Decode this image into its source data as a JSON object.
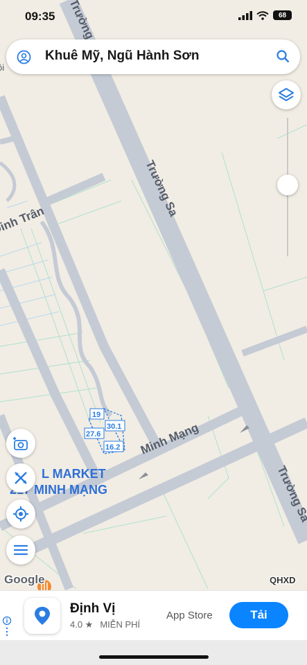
{
  "status_bar": {
    "time": "09:35",
    "battery": "68"
  },
  "search": {
    "query": "Khuê Mỹ, Ngũ Hành Sơn"
  },
  "map": {
    "street_labels": [
      "Trường Sa",
      "Trường Sa",
      "Trường Sa",
      "Minh Mạng",
      "Đinh Trân"
    ],
    "place_labels": [
      "L MARKET",
      "217 MINH MẠNG"
    ],
    "parcel_labels": [
      "19",
      "30.1",
      "27.6",
      "16.2"
    ],
    "attribution": "Google",
    "badge": "QHXD",
    "cut_label": "ội"
  },
  "ad": {
    "app_name": "Định Vị",
    "rating": "4.0 ★",
    "price": "MIỄN PHÍ",
    "store": "App Store",
    "install_label": "Tải"
  },
  "colors": {
    "accent": "#0a84ff",
    "map_bg": "#f1ede4",
    "road": "#c5cbd5",
    "parcel": "#2a7de1"
  }
}
